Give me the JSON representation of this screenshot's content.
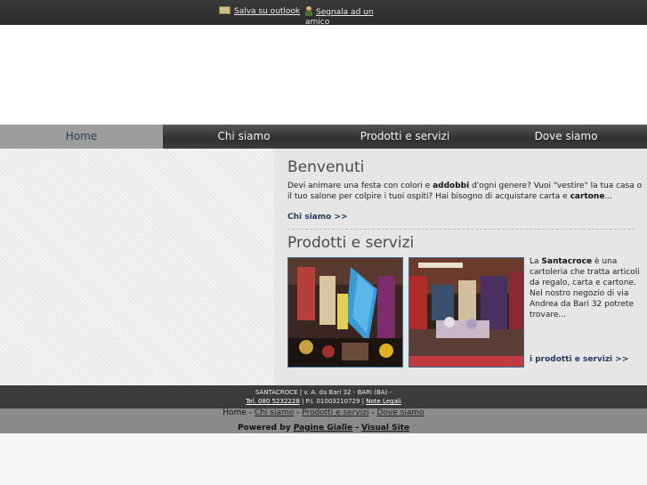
{
  "topbar": {
    "save_outlook": "Salva su outlook",
    "tell_friend_line1": "Segnala ad un",
    "tell_friend_line2": "amico",
    "icons": [
      "envelope-icon",
      "person-icon"
    ]
  },
  "nav": {
    "items": [
      {
        "label": "Home",
        "active": true
      },
      {
        "label": "Chi siamo",
        "active": false
      },
      {
        "label": "Prodotti e servizi",
        "active": false
      },
      {
        "label": "Dove siamo",
        "active": false
      }
    ]
  },
  "welcome": {
    "title": "Benvenuti",
    "text_1": "Devi animare una festa con colori e ",
    "bold_1": "addobbi",
    "text_2": " d'ogni genere? Vuoi \"vestire\" la tua casa o",
    "text_3": "il tuo salone per colpire i tuoi ospiti? Hai bisogno di acquistare carta e ",
    "bold_2": "cartone",
    "text_4": "...",
    "link": "Chi siamo >>"
  },
  "products": {
    "title": "Prodotti e servizi",
    "desc_1": "La ",
    "desc_bold": "Santacroce",
    "desc_2": " è una cartoleria che tratta articoli da regalo, carta e cartone.",
    "desc_3": "Nel nostro negozio di via Andrea da Bari 32 potrete trovare...",
    "link": "i prodotti e servizi >>"
  },
  "footer": {
    "address": "SANTACROCE | v. A. da Bari 32 - BARI (BA) -",
    "tel": "Tel. 080 5232228",
    "piva": " | P.I. 01003210729 | ",
    "legal": "Note Legali",
    "nav_home": "Home",
    "nav_sep": " - ",
    "nav_chi": "Chi siamo",
    "nav_prod": "Prodotti e servizi",
    "nav_dove": "Dove siamo",
    "powered_label": "Powered by ",
    "powered_pg": "Pagine Gialle",
    "powered_sep": " - ",
    "powered_vs": "Visual Site"
  }
}
